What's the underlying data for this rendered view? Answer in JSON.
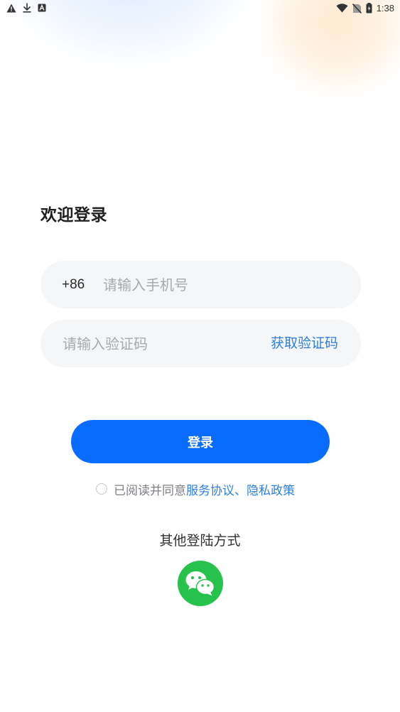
{
  "status_bar": {
    "time": "1:38",
    "left_icons": [
      "warning-icon",
      "download-icon",
      "a-box-icon"
    ],
    "right_icons": [
      "wifi-icon",
      "no-sim-icon",
      "battery-icon"
    ]
  },
  "login": {
    "title": "欢迎登录",
    "phone": {
      "country_code": "+86",
      "placeholder": "请输入手机号",
      "value": ""
    },
    "code": {
      "placeholder": "请输入验证码",
      "value": "",
      "get_code_label": "获取验证码"
    },
    "submit_label": "登录",
    "agreement": {
      "prefix": "已阅读并同意",
      "service_link": "服务协议",
      "separator": "、",
      "privacy_link": "隐私政策",
      "checked": false
    },
    "other_methods": {
      "title": "其他登陆方式",
      "methods": [
        "wechat-icon"
      ]
    }
  },
  "colors": {
    "primary": "#0a6cff",
    "link": "#2f7fe0",
    "wechat": "#27c24c",
    "input_bg": "#f5f6f7"
  }
}
